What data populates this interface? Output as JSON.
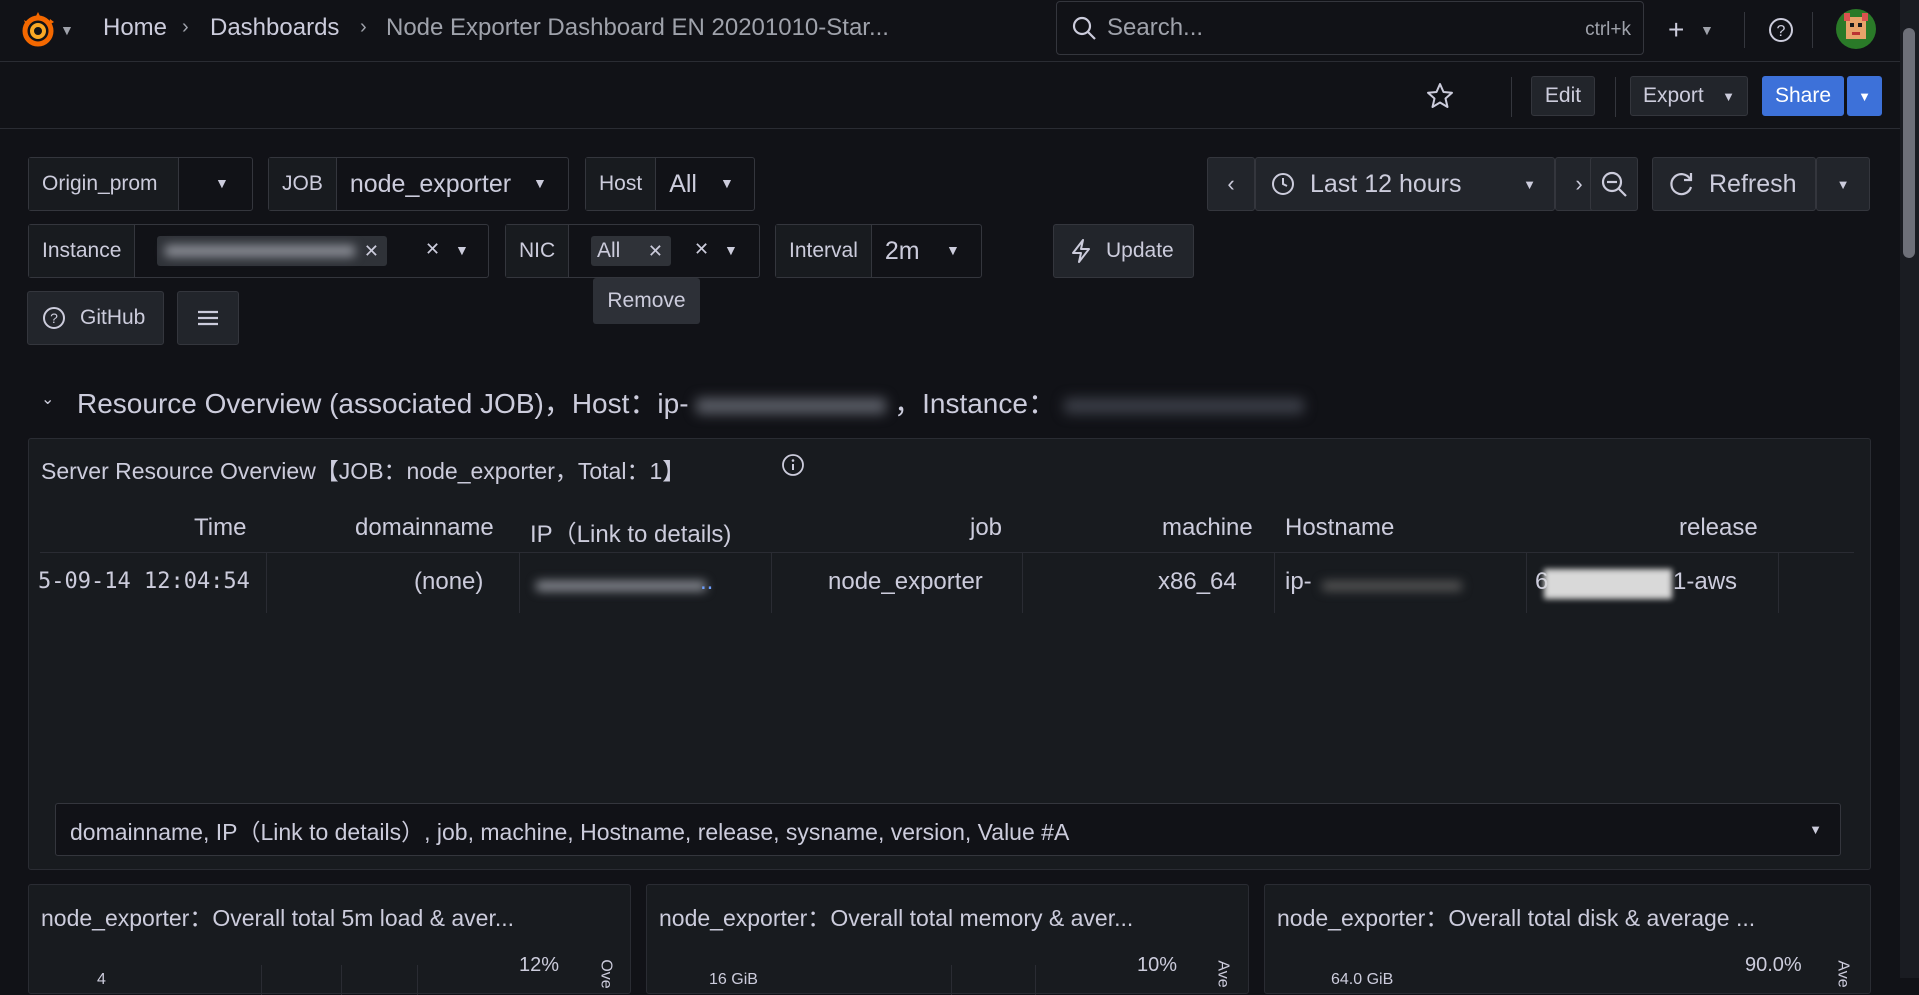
{
  "breadcrumb": {
    "home": "Home",
    "dashboards": "Dashboards",
    "current": "Node Exporter Dashboard EN 20201010-Star..."
  },
  "search": {
    "placeholder": "Search...",
    "shortcut": "ctrl+k"
  },
  "toolbar": {
    "edit": "Edit",
    "export": "Export",
    "share": "Share"
  },
  "variables": {
    "datasource": "Origin_prom",
    "job_label": "JOB",
    "job_value": "node_exporter",
    "host_label": "Host",
    "host_value": "All",
    "instance_label": "Instance",
    "nic_label": "NIC",
    "nic_chip": "All",
    "interval_label": "Interval",
    "interval_value": "2m",
    "update": "Update",
    "github": "GitHub"
  },
  "time": {
    "range": "Last 12 hours",
    "refresh": "Refresh"
  },
  "tooltip": "Remove",
  "row": {
    "title": "Resource Overview (associated JOB)，Host：ip-",
    "instance": "，Instance："
  },
  "panel": {
    "title": "Server Resource Overview【JOB：node_exporter，Total：1】",
    "columns": [
      "Time",
      "domainname",
      "IP（Link to details)",
      "job",
      "machine",
      "Hostname",
      "release"
    ],
    "row": {
      "time": "5-09-14 12:04:54",
      "domainname": "(none)",
      "ip_suffix": "..",
      "job": "node_exporter",
      "machine": "x86_64",
      "hostname": "ip-",
      "release_prefix": "6",
      "release_suffix": "1-aws"
    },
    "fields": "domainname, IP（Link to details）, job, machine, Hostname, release, sysname, version, Value #A"
  },
  "bottom_panels": [
    {
      "title": "node_exporter：Overall total 5m load & aver...",
      "right_tick": "12%",
      "left_tick": "4",
      "axis": "Ove"
    },
    {
      "title": "node_exporter：Overall total memory & aver...",
      "right_tick": "10%",
      "left_tick": "16 GiB",
      "axis": "Ave"
    },
    {
      "title": "node_exporter：Overall total disk & average ...",
      "right_tick": "90.0%",
      "left_tick": "64.0 GiB",
      "axis": "Ave"
    }
  ],
  "colors": {
    "bg": "#111217",
    "panel": "#181b1f",
    "accent": "#3d71d9",
    "border": "#34363d"
  },
  "icons": [
    "grafana-logo-icon",
    "search-icon",
    "plus-icon",
    "help-icon",
    "star-icon",
    "clock-icon",
    "zoom-out-icon",
    "refresh-icon",
    "bolt-icon",
    "menu-icon",
    "info-icon"
  ]
}
